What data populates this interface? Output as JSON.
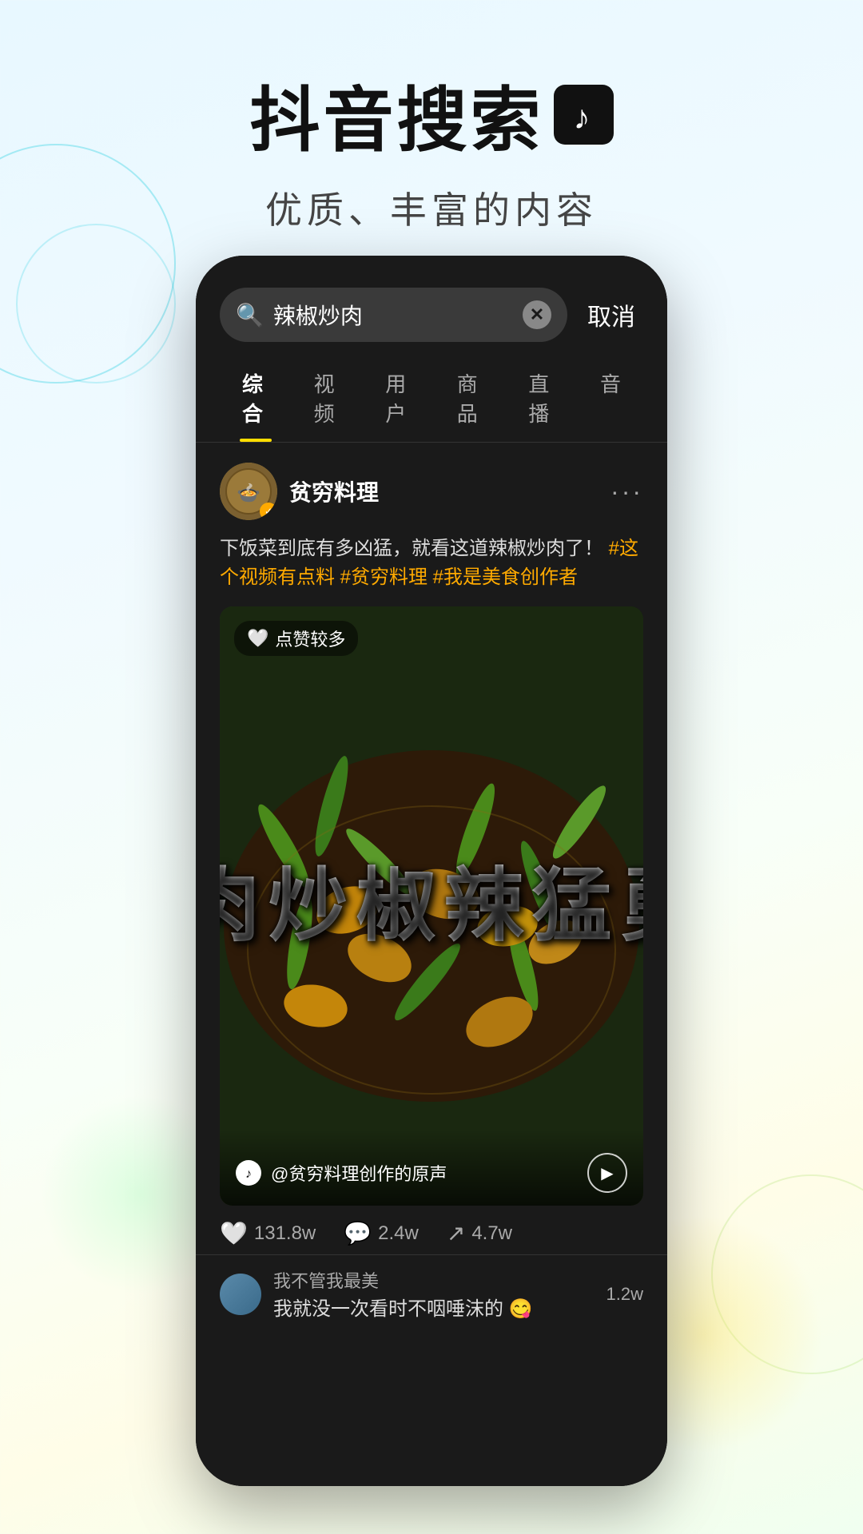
{
  "page": {
    "background": "light-gradient"
  },
  "header": {
    "main_title": "抖音搜索",
    "subtitle": "优质、丰富的内容"
  },
  "phone": {
    "search_bar": {
      "query": "辣椒炒肉",
      "cancel_label": "取消"
    },
    "tabs": [
      {
        "label": "综合",
        "active": true
      },
      {
        "label": "视频",
        "active": false
      },
      {
        "label": "用户",
        "active": false
      },
      {
        "label": "商品",
        "active": false
      },
      {
        "label": "直播",
        "active": false
      },
      {
        "label": "音",
        "active": false
      }
    ],
    "post": {
      "username": "贫穷料理",
      "verified": true,
      "description": "下饭菜到底有多凶猛，就看这道辣椒炒肉了！",
      "hashtags": [
        "#这个视频有点料",
        "#贫穷料理",
        "#我是美食创作者"
      ],
      "likes_badge": "点赞较多",
      "video_text": "勇猛辣椒炒肉",
      "video_source": "@贫穷料理创作的原声",
      "engagement": {
        "likes": "131.8w",
        "comments": "2.4w",
        "shares": "4.7w"
      },
      "comment_user": "我不管我最美",
      "comment_text": "我就没一次看时不咽唾沫的",
      "comment_count": "1.2w"
    }
  }
}
